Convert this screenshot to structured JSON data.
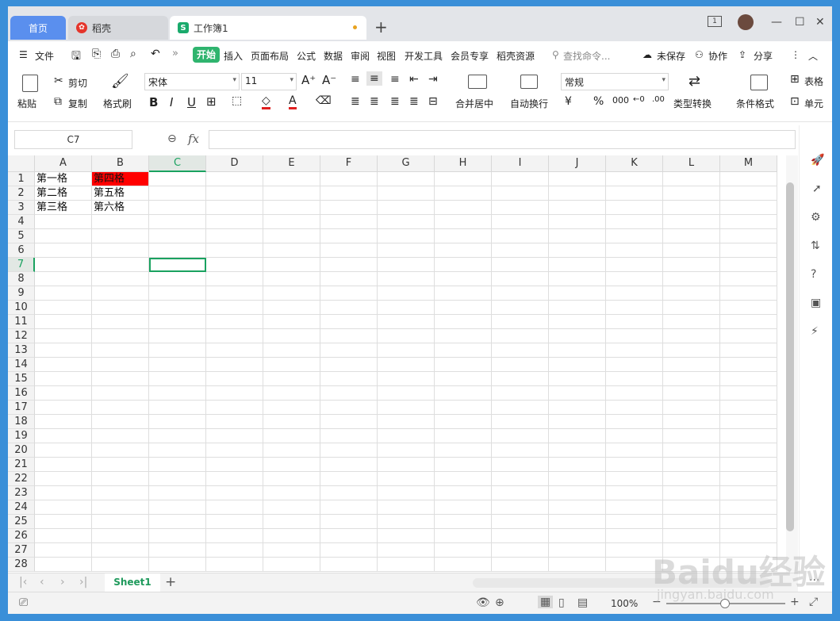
{
  "tabs": {
    "home": "首页",
    "daoke": "稻壳",
    "workbook": "工作簿1"
  },
  "menu": {
    "file": "文件",
    "start": "开始",
    "items": [
      "插入",
      "页面布局",
      "公式",
      "数据",
      "审阅",
      "视图",
      "开发工具",
      "会员专享",
      "稻壳资源"
    ],
    "search_placeholder": "查找命令...",
    "unsaved": "未保存",
    "collab": "协作",
    "share": "分享"
  },
  "ribbon": {
    "paste": "粘贴",
    "cut": "剪切",
    "copy": "复制",
    "format_painter": "格式刷",
    "font_name": "宋体",
    "font_size": "11",
    "merge_center": "合并居中",
    "wrap_text": "自动换行",
    "number_format": "常规",
    "type_convert": "类型转换",
    "cond_format": "条件格式",
    "table_style": "表格",
    "cell": "单元"
  },
  "formula_bar": {
    "name_box": "C7",
    "fx": "fx",
    "value": ""
  },
  "sheet": {
    "columns": [
      "A",
      "B",
      "C",
      "D",
      "E",
      "F",
      "G",
      "H",
      "I",
      "J",
      "K",
      "L",
      "M"
    ],
    "rows": [
      "1",
      "2",
      "3",
      "4",
      "5",
      "6",
      "7",
      "8",
      "9",
      "10",
      "11",
      "12",
      "13",
      "14",
      "15",
      "16",
      "17",
      "18",
      "19",
      "20",
      "21",
      "22",
      "23",
      "24",
      "25",
      "26",
      "27",
      "28"
    ],
    "cells": {
      "A1": "第一格",
      "B1": "第四格",
      "A2": "第二格",
      "B2": "第五格",
      "A3": "第三格",
      "B3": "第六格"
    },
    "highlight_color": "#ff0000",
    "selected_cell": "C7",
    "accent_color": "#1aa260"
  },
  "sheetbar": {
    "sheet_name": "Sheet1"
  },
  "status": {
    "zoom": "100%"
  },
  "watermark": {
    "main": "Baidu经验",
    "sub": "jingyan.baidu.com"
  }
}
